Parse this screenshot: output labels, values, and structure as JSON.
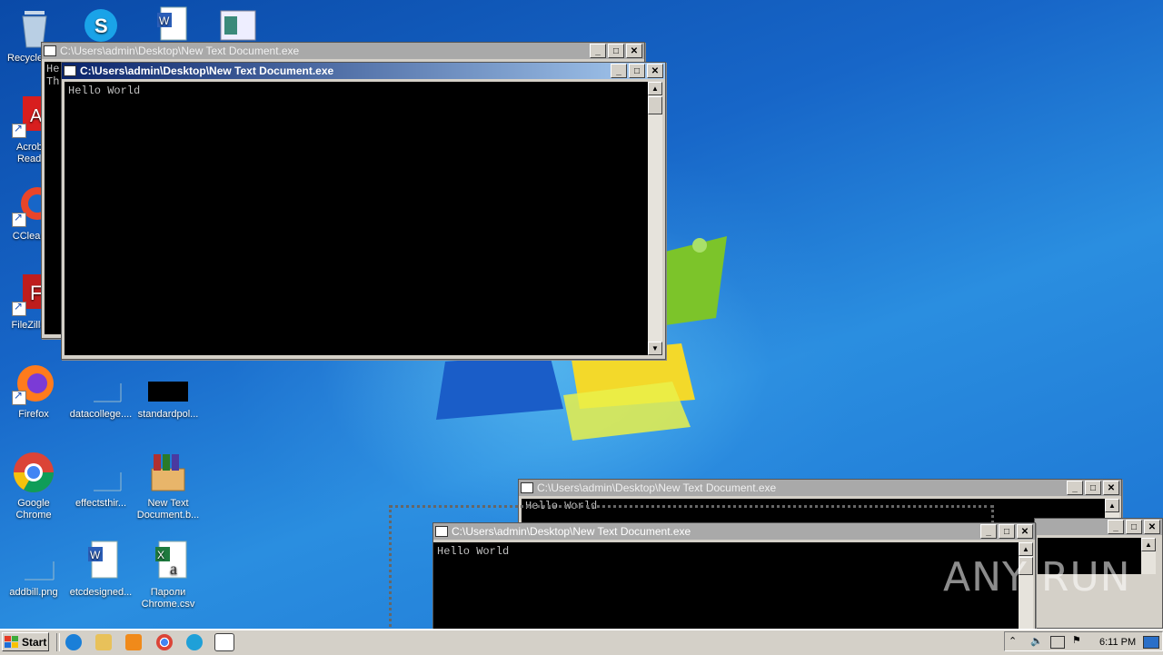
{
  "desktop": {
    "icons": [
      {
        "label": "Recycle Bin",
        "icon": "recycle-bin-icon"
      },
      {
        "label": "",
        "icon": "skype-icon"
      },
      {
        "label": "",
        "icon": "word-doc-icon"
      },
      {
        "label": "",
        "icon": "image-icon"
      },
      {
        "label": "Acrobat Reader",
        "icon": "acrobat-icon"
      },
      {
        "label": "CCleaner",
        "icon": "ccleaner-icon"
      },
      {
        "label": "FileZilla C",
        "icon": "filezilla-icon"
      },
      {
        "label": "Firefox",
        "icon": "firefox-icon"
      },
      {
        "label": "datacollege....",
        "icon": "blank-file-icon"
      },
      {
        "label": "standardpol...",
        "icon": "black-image-icon"
      },
      {
        "label": "Google Chrome",
        "icon": "chrome-icon"
      },
      {
        "label": "effectsthir...",
        "icon": "blank-file-icon"
      },
      {
        "label": "New Text Document.b...",
        "icon": "winrar-icon"
      },
      {
        "label": "addbill.png",
        "icon": "blank-file-icon"
      },
      {
        "label": "etcdesigned...",
        "icon": "word-doc-icon"
      },
      {
        "label": "Пароли Chrome.csv",
        "icon": "excel-csv-icon"
      }
    ]
  },
  "windows": [
    {
      "title": "C:\\Users\\admin\\Desktop\\New Text Document.exe",
      "content": "He\nTh"
    },
    {
      "title": "C:\\Users\\admin\\Desktop\\New Text Document.exe",
      "content": "Hello World"
    },
    {
      "title": "C:\\Users\\admin\\Desktop\\New Text Document.exe",
      "content": "Hello World"
    },
    {
      "title": "C:\\Users\\admin\\Desktop\\New Text Document.exe",
      "content": "Hello World"
    }
  ],
  "controls": {
    "minimize": "_",
    "maximize": "□",
    "close": "✕"
  },
  "taskbar": {
    "start_label": "Start",
    "pinned": [
      "ie-icon",
      "explorer-icon",
      "media-player-icon",
      "chrome-icon",
      "edge-icon",
      "console-icon"
    ],
    "tray": {
      "time": "6:11 PM",
      "icons": [
        "up-arrow-icon",
        "speaker-icon",
        "network-icon",
        "flag-icon",
        "desktop-icon"
      ]
    }
  },
  "watermark": "ANY RUN",
  "colors": {
    "titlebar_active_start": "#0a246a",
    "titlebar_active_end": "#a6caf0",
    "console_bg": "#000000",
    "console_fg": "#c0c0c0"
  }
}
